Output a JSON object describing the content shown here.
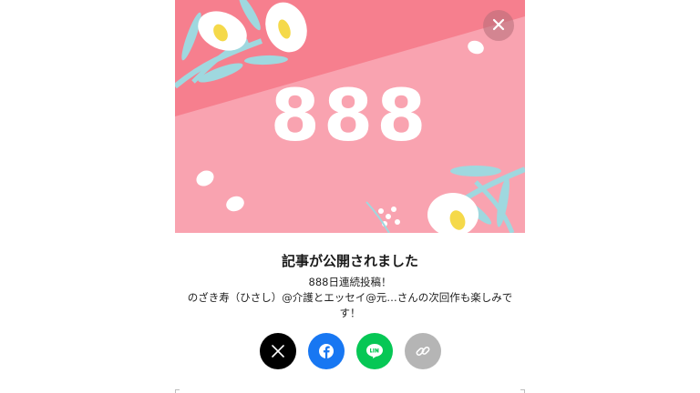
{
  "modal": {
    "milestone": "888",
    "title": "記事が公開されました",
    "message_line1": "888日連続投稿！",
    "message_line2": "のざき寿（ひさし）@介護とエッセイ@元…さんの次回作も楽しみです！"
  },
  "icons": {
    "close": "close-icon",
    "x": "x-logo-icon",
    "facebook": "facebook-icon",
    "line": "line-icon",
    "link": "link-icon"
  },
  "colors": {
    "hero_pink_top": "#f67f8e",
    "hero_pink_bottom": "#f9a3b0",
    "x_button": "#000000",
    "facebook_button": "#1877f2",
    "line_button": "#06c755",
    "link_button": "#b5b5b5"
  }
}
